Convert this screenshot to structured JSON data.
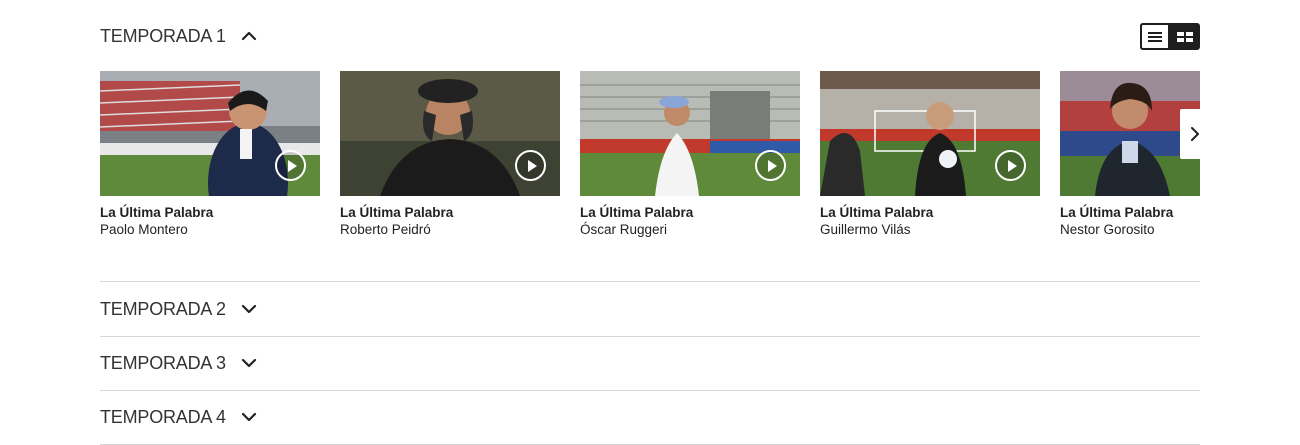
{
  "seasons": [
    {
      "label": "TEMPORADA 1",
      "expanded": true
    },
    {
      "label": "TEMPORADA 2",
      "expanded": false
    },
    {
      "label": "TEMPORADA 3",
      "expanded": false
    },
    {
      "label": "TEMPORADA 4",
      "expanded": false
    }
  ],
  "view_toggle": {
    "options": [
      "list-view-icon",
      "grid-view-icon"
    ],
    "selected": "list-view-icon"
  },
  "episodes": [
    {
      "show": "La Última Palabra",
      "guest": "Paolo Montero"
    },
    {
      "show": "La Última Palabra",
      "guest": "Roberto Peidró"
    },
    {
      "show": "La Última Palabra",
      "guest": "Óscar Ruggeri"
    },
    {
      "show": "La Última Palabra",
      "guest": "Guillermo Vilás"
    },
    {
      "show": "La Última Palabra",
      "guest": "Nestor Gorosito"
    }
  ],
  "icons": {
    "play": "play-circle-icon",
    "next": "chevron-right-icon"
  },
  "colors": {
    "toggle_bg": "#1e1e1e",
    "divider": "#d6d6d6",
    "text": "#222222"
  }
}
